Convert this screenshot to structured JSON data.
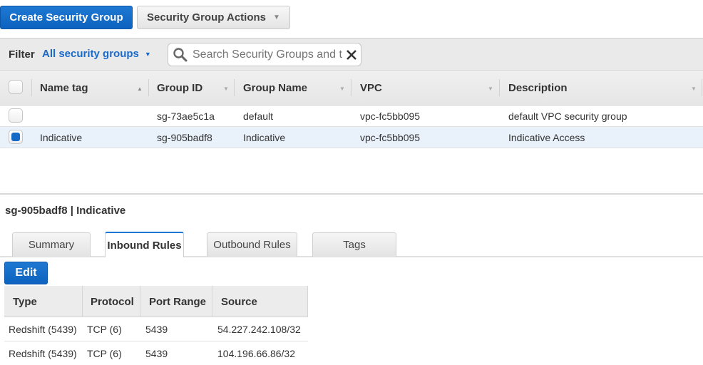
{
  "toolbar": {
    "create_label": "Create Security Group",
    "actions_label": "Security Group Actions",
    "actions_icon": "chevron-down-icon"
  },
  "filter": {
    "label": "Filter",
    "selected": "All security groups",
    "search_placeholder": "Search Security Groups and t",
    "search_icon": "search-icon",
    "clear_icon": "close-icon"
  },
  "table": {
    "columns": [
      "Name tag",
      "Group ID",
      "Group Name",
      "VPC",
      "Description"
    ],
    "sort_column": "Name tag",
    "sort_direction": "ascending",
    "rows": [
      {
        "selected": false,
        "name_tag": "",
        "group_id": "sg-73ae5c1a",
        "group_name": "default",
        "vpc": "vpc-fc5bb095",
        "description": "default VPC security group"
      },
      {
        "selected": true,
        "name_tag": "Indicative",
        "group_id": "sg-905badf8",
        "group_name": "Indicative",
        "vpc": "vpc-fc5bb095",
        "description": "Indicative Access"
      }
    ]
  },
  "detail": {
    "title": "sg-905badf8 | Indicative",
    "tabs": [
      "Summary",
      "Inbound Rules",
      "Outbound Rules",
      "Tags"
    ],
    "active_tab": "Inbound Rules",
    "edit_label": "Edit",
    "rules": {
      "columns": [
        "Type",
        "Protocol",
        "Port Range",
        "Source"
      ],
      "rows": [
        [
          "Redshift (5439)",
          "TCP (6)",
          "5439",
          "54.227.242.108/32"
        ],
        [
          "Redshift (5439)",
          "TCP (6)",
          "5439",
          "104.196.66.86/32"
        ]
      ]
    }
  },
  "colors": {
    "primary": "#1569c7",
    "link": "#1b6ac9",
    "selected_row": "#e9f1fb"
  }
}
